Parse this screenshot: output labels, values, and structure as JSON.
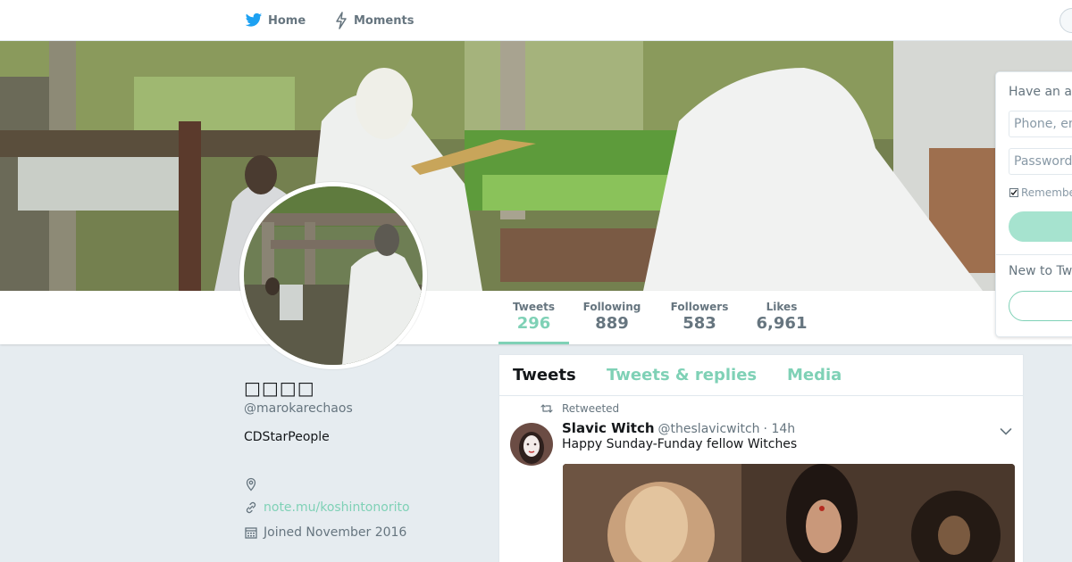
{
  "nav": {
    "home_label": "Home",
    "moments_label": "Moments"
  },
  "stats": [
    {
      "label": "Tweets",
      "value": "296"
    },
    {
      "label": "Following",
      "value": "889"
    },
    {
      "label": "Followers",
      "value": "583"
    },
    {
      "label": "Likes",
      "value": "6,961"
    }
  ],
  "profile": {
    "name": "□□□□",
    "handle": "@marokarechaos",
    "bio": "CDStarPeople",
    "link": "note.mu/koshintonorito",
    "joined": "Joined November 2016"
  },
  "timeline": {
    "tabs": [
      "Tweets",
      "Tweets & replies",
      "Media"
    ],
    "retweeted_label": "Retweeted",
    "tweet": {
      "name": "Slavic Witch",
      "handle": "@theslavicwitch",
      "time": "· 14h",
      "text": "Happy Sunday-Funday fellow Witches"
    }
  },
  "login": {
    "title": "Have an a",
    "phone_placeholder": "Phone, em",
    "password_placeholder": "Password",
    "remember_label": "Remembe",
    "new_label": "New to Tw"
  },
  "colors": {
    "accent": "#7fd1b6",
    "nav_icon": "#1da1f2",
    "background": "#e6ecf0"
  }
}
